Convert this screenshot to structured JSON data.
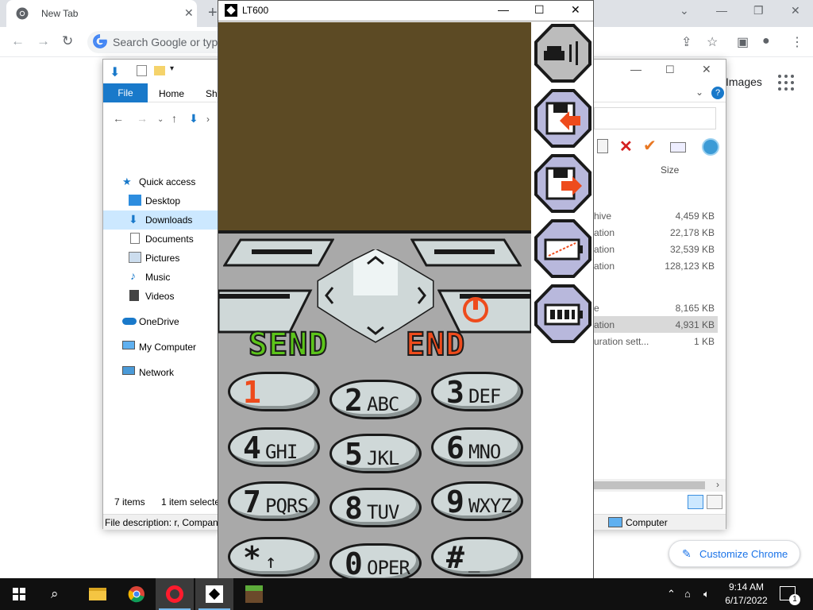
{
  "chrome": {
    "tab_title": "New Tab",
    "omnibox_placeholder": "Search Google or type",
    "images_link": "Images",
    "customize_label": "Customize Chrome"
  },
  "explorer": {
    "ribbon_tabs": [
      "File",
      "Home",
      "Sha"
    ],
    "sidebar": [
      "Quick access",
      "Desktop",
      "Downloads",
      "Documents",
      "Pictures",
      "Music",
      "Videos",
      "OneDrive",
      "My Computer",
      "Network"
    ],
    "size_header": "Size",
    "rows": [
      {
        "name": "hive",
        "size": "4,459 KB"
      },
      {
        "name": "ation",
        "size": "22,178 KB"
      },
      {
        "name": "ation",
        "size": "32,539 KB"
      },
      {
        "name": "ation",
        "size": "128,123 KB"
      },
      {
        "name": "e",
        "size": "8,165 KB"
      },
      {
        "name": "ation",
        "size": "4,931 KB"
      },
      {
        "name": "uration sett...",
        "size": "1 KB"
      }
    ],
    "status_items": "7 items",
    "status_selected": "1 item selecte",
    "file_description": "File description: r, Compan",
    "computer_label": "Computer"
  },
  "lt600": {
    "title": "LT600",
    "send_label": "SEND",
    "end_label": "END",
    "keys": [
      {
        "num": "1",
        "letters": ""
      },
      {
        "num": "2",
        "letters": "ABC"
      },
      {
        "num": "3",
        "letters": "DEF"
      },
      {
        "num": "4",
        "letters": "GHI"
      },
      {
        "num": "5",
        "letters": "JKL"
      },
      {
        "num": "6",
        "letters": "MNO"
      },
      {
        "num": "7",
        "letters": "PQRS"
      },
      {
        "num": "8",
        "letters": "TUV"
      },
      {
        "num": "9",
        "letters": "WXYZ"
      },
      {
        "num": "*",
        "letters": "↑"
      },
      {
        "num": "0",
        "letters": "OPER"
      },
      {
        "num": "#",
        "letters": "_"
      }
    ],
    "colors": {
      "screen": "#5c4a24",
      "body": "#a9a9a9",
      "send": "#5cc41a",
      "end": "#ee4b1c",
      "side_button": "#b8b8dc"
    }
  },
  "taskbar": {
    "time": "9:14 AM",
    "date": "6/17/2022",
    "notification_count": "1"
  }
}
